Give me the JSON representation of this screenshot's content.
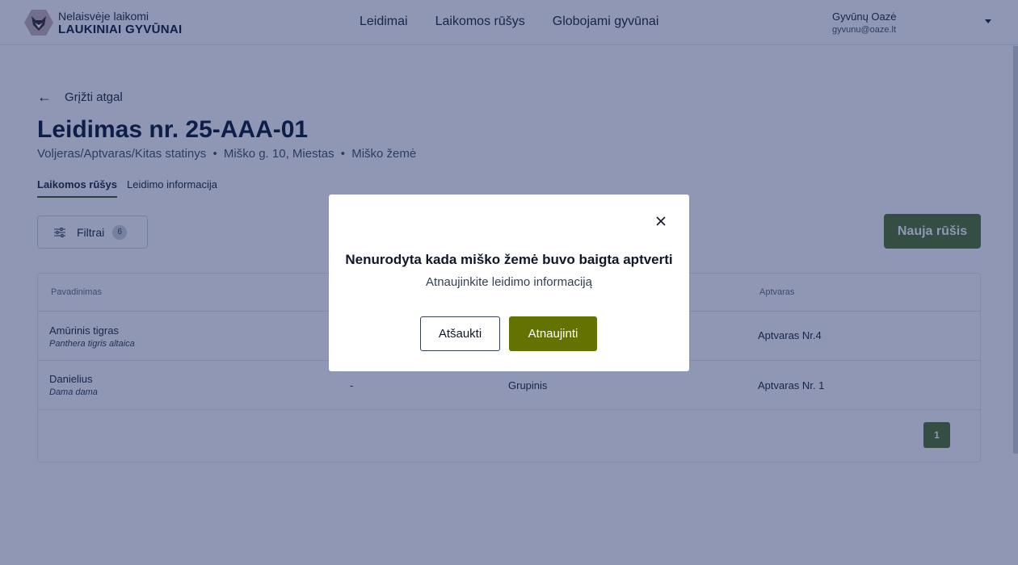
{
  "header": {
    "logo": {
      "line1": "Nelaisvėje laikomi",
      "line2": "LAUKINIAI GYVŪNAI"
    },
    "nav": [
      {
        "label": "Leidimai"
      },
      {
        "label": "Laikomos rūšys"
      },
      {
        "label": "Globojami gyvūnai"
      }
    ],
    "user": {
      "name": "Gyvūnų Oazė",
      "email": "gyvunu@oaze.lt"
    }
  },
  "page": {
    "back_label": "Grįžti atgal",
    "title": "Leidimas nr. 25-AAA-01",
    "subtitle": {
      "part1": "Voljeras/Aptvaras/Kitas statinys",
      "separator": "•",
      "part2": "Miško g. 10, Miestas",
      "part3": "Miško žemė"
    },
    "tabs": [
      {
        "label": "Laikomos rūšys",
        "active": true
      },
      {
        "label": "Leidimo informacija",
        "active": false
      }
    ],
    "filter": {
      "label": "Filtrai",
      "count": "6"
    },
    "new_button_label": "Nauja rūšis"
  },
  "table": {
    "columns": {
      "name": "Pavadinimas",
      "enclosure": "Aptvaras"
    },
    "rows": [
      {
        "name": "Amūrinis tigras",
        "latin": "Panthera tigris altaica",
        "col2": "",
        "col3": "",
        "enclosure": "Aptvaras Nr.4"
      },
      {
        "name": "Danielius",
        "latin": "Dama dama",
        "col2": "-",
        "col3": "Grupinis",
        "enclosure": "Aptvaras Nr. 1"
      }
    ],
    "current_page": "1"
  },
  "modal": {
    "title": "Nenurodyta kada miško žemė buvo baigta aptverti",
    "text": "Atnaujinkite leidimo informaciją",
    "cancel_label": "Atšaukti",
    "confirm_label": "Atnaujinti"
  },
  "colors": {
    "primary_green": "#53762b",
    "confirm_olive": "#637200",
    "overlay": "#10235f"
  }
}
